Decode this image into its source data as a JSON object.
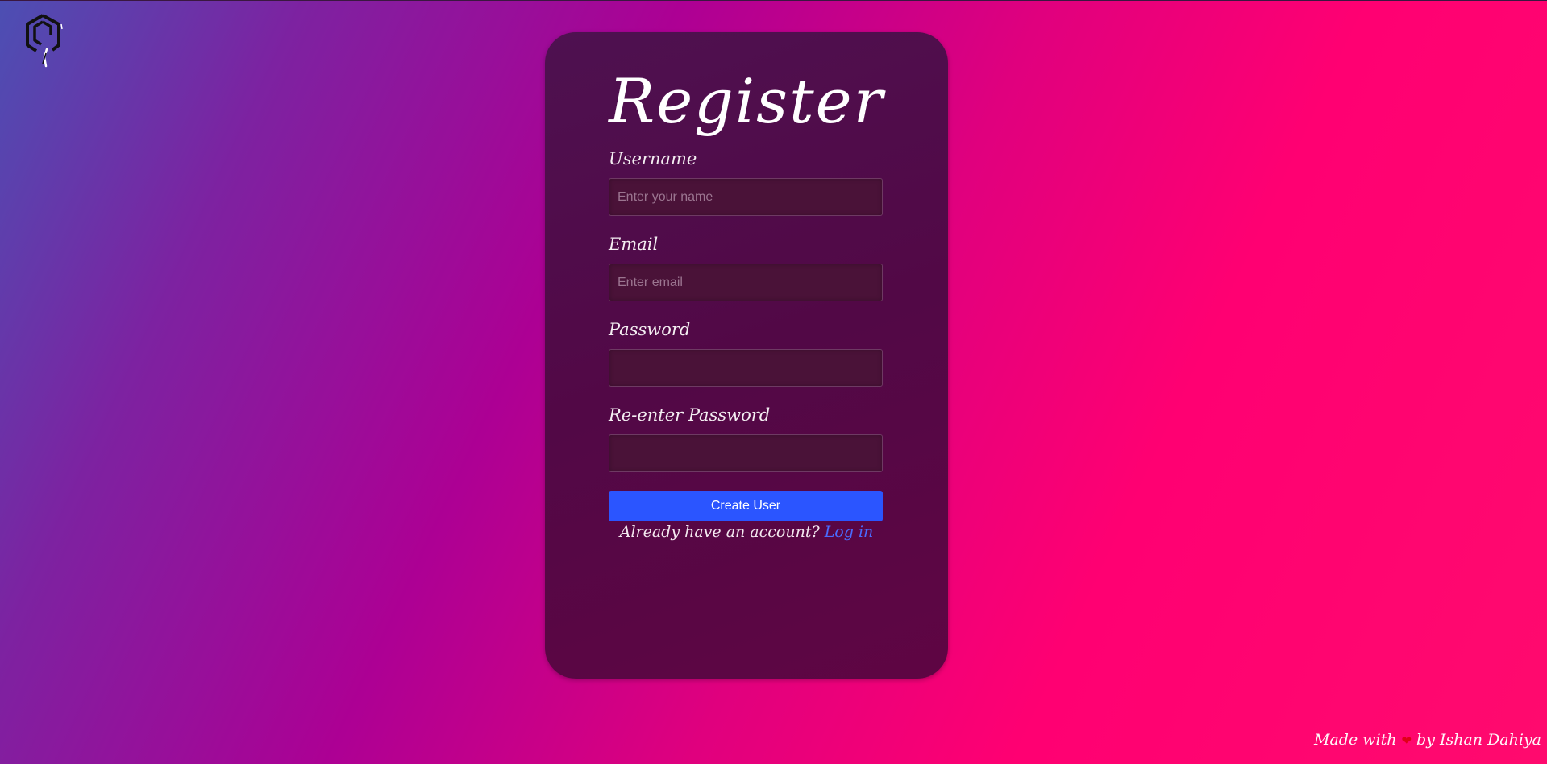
{
  "app": {
    "logo_name": "hexagon-logo"
  },
  "form": {
    "title": "Register",
    "username": {
      "label": "Username",
      "placeholder": "Enter your name",
      "value": ""
    },
    "email": {
      "label": "Email",
      "placeholder": "Enter email",
      "value": ""
    },
    "password": {
      "label": "Password",
      "placeholder": "",
      "value": ""
    },
    "reenter_password": {
      "label": "Re-enter Password",
      "placeholder": "",
      "value": ""
    },
    "submit_label": "Create User",
    "login_prompt": "Already have an account?",
    "login_link": "Log in"
  },
  "footer": {
    "prefix": "Made with",
    "heart_icon": "heart-icon",
    "suffix": "by Ishan Dahiya"
  },
  "colors": {
    "accent": "#2b55ff",
    "link": "#4a6bff",
    "card": "#520846",
    "heart": "#e00018"
  }
}
